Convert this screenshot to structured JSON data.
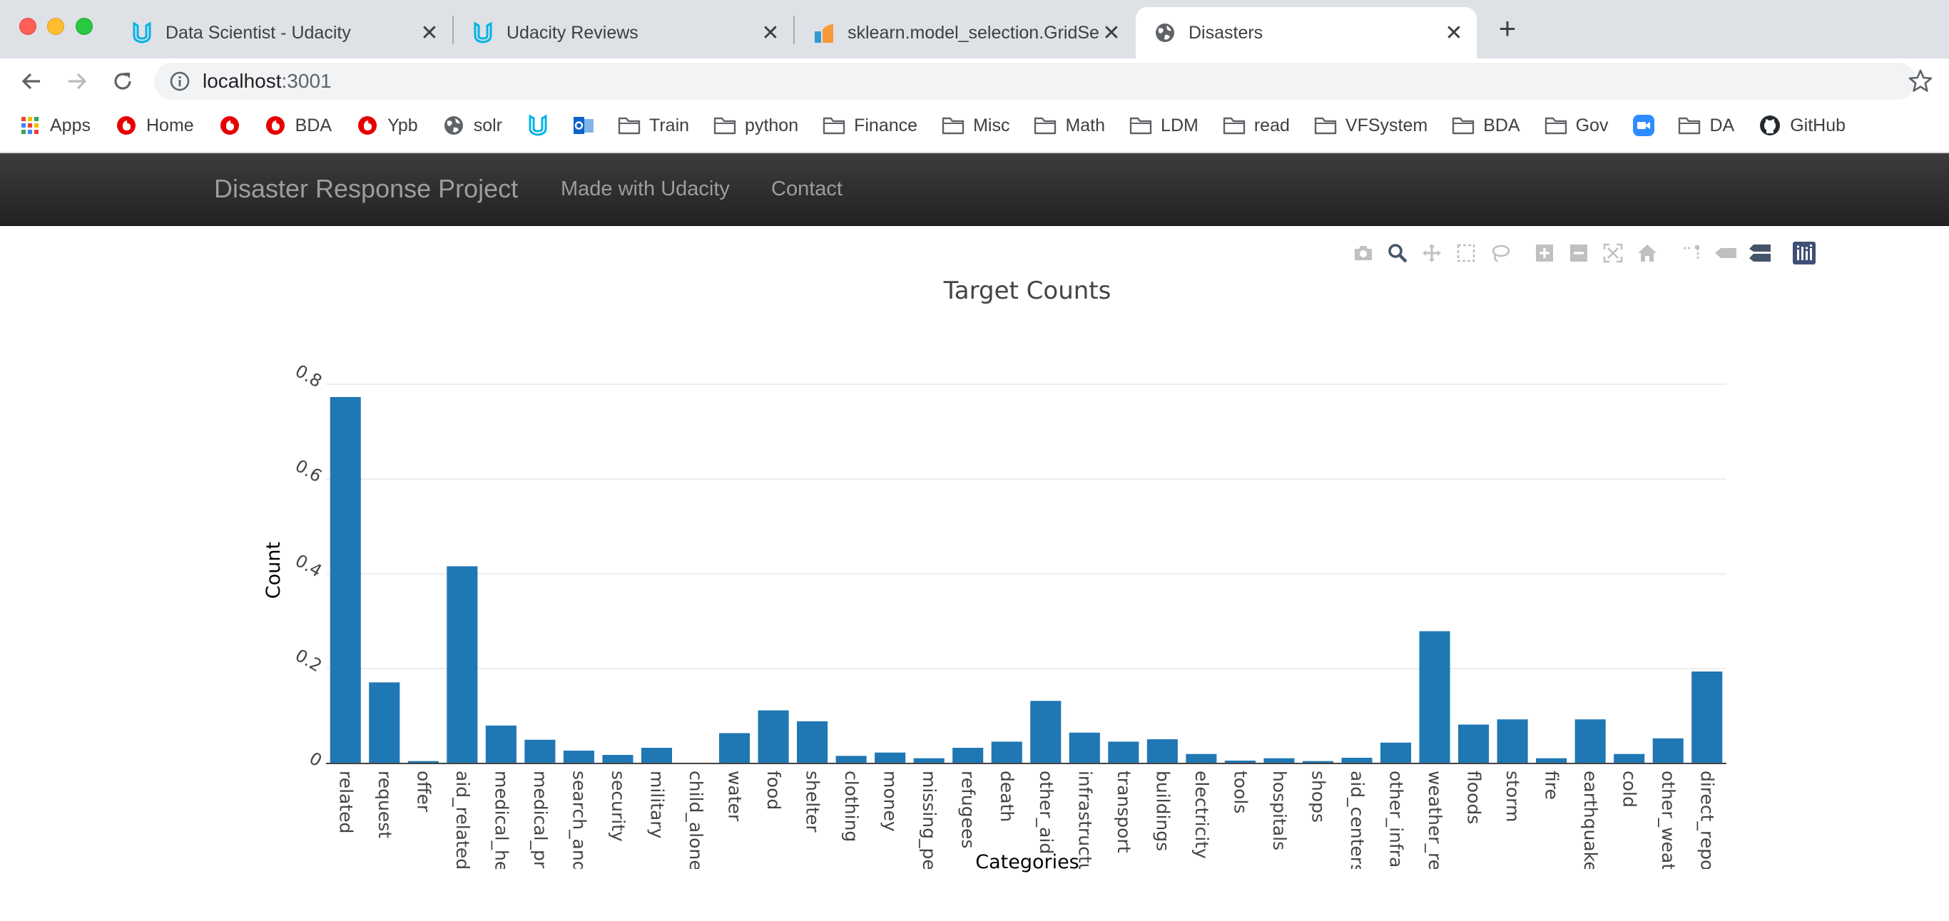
{
  "browser": {
    "tabs": [
      {
        "title": "Data Scientist - Udacity",
        "icon": "udacity-icon",
        "active": false
      },
      {
        "title": "Udacity Reviews",
        "icon": "udacity-icon",
        "active": false
      },
      {
        "title": "sklearn.model_selection.GridSe",
        "icon": "sklearn-icon",
        "active": false
      },
      {
        "title": "Disasters",
        "icon": "globe-icon",
        "active": true
      }
    ],
    "new_tab_label": "+",
    "close_glyph": "✕",
    "url_host": "localhost",
    "url_port": ":3001",
    "bookmarks": [
      {
        "label": "Apps",
        "icon": "apps-grid-icon"
      },
      {
        "label": "Home",
        "icon": "vodafone-icon"
      },
      {
        "label": "",
        "icon": "vodafone-icon"
      },
      {
        "label": "BDA",
        "icon": "vodafone-icon"
      },
      {
        "label": "Ypb",
        "icon": "vodafone-icon"
      },
      {
        "label": "solr",
        "icon": "globe-icon"
      },
      {
        "label": "",
        "icon": "udacity-icon"
      },
      {
        "label": "",
        "icon": "outlook-icon"
      },
      {
        "label": "Train",
        "icon": "folder-icon"
      },
      {
        "label": "python",
        "icon": "folder-icon"
      },
      {
        "label": "Finance",
        "icon": "folder-icon"
      },
      {
        "label": "Misc",
        "icon": "folder-icon"
      },
      {
        "label": "Math",
        "icon": "folder-icon"
      },
      {
        "label": "LDM",
        "icon": "folder-icon"
      },
      {
        "label": "read",
        "icon": "folder-icon"
      },
      {
        "label": "VFSystem",
        "icon": "folder-icon"
      },
      {
        "label": "BDA",
        "icon": "folder-icon"
      },
      {
        "label": "Gov",
        "icon": "folder-icon"
      },
      {
        "label": "",
        "icon": "zoom-icon"
      },
      {
        "label": "DA",
        "icon": "folder-icon"
      },
      {
        "label": "GitHub",
        "icon": "github-icon"
      }
    ]
  },
  "site": {
    "brand": "Disaster Response Project",
    "links": [
      "Made with Udacity",
      "Contact"
    ]
  },
  "modebar": {
    "buttons": [
      "camera-icon",
      "zoom-icon",
      "pan-icon",
      "box-select-icon",
      "lasso-select-icon",
      "zoom-in-icon",
      "zoom-out-icon",
      "autoscale-icon",
      "reset-axes-icon",
      "spike-lines-icon",
      "hover-closest-icon",
      "hover-compare-icon",
      "plotly-logo-icon"
    ]
  },
  "colors": {
    "bar": "#1f77b4",
    "grid": "#eeeeee",
    "navbar": "#222222",
    "nav_text": "#9d9d9d"
  },
  "chart_data": {
    "type": "bar",
    "title": "Target Counts",
    "xlabel": "Categories",
    "ylabel": "Count",
    "ylim": [
      0,
      0.8
    ],
    "yticks": [
      0,
      0.2,
      0.4,
      0.6,
      0.8
    ],
    "ytick_labels": [
      "0",
      "0.2",
      "0.4",
      "0.6",
      "0.8"
    ],
    "grid": true,
    "categories": [
      "related",
      "request",
      "offer",
      "aid_related",
      "medical_hel",
      "medical_pro",
      "search_and_",
      "security",
      "military",
      "child_alone",
      "water",
      "food",
      "shelter",
      "clothing",
      "money",
      "missing_pec",
      "refugees",
      "death",
      "other_aid",
      "infrastructur",
      "transport",
      "buildings",
      "electricity",
      "tools",
      "hospitals",
      "shops",
      "aid_centers",
      "other_infras",
      "weather_rel.",
      "floods",
      "storm",
      "fire",
      "earthquake",
      "cold",
      "other_weath",
      "direct_repor"
    ],
    "values": [
      0.773,
      0.171,
      0.005,
      0.416,
      0.08,
      0.05,
      0.027,
      0.018,
      0.033,
      0.0,
      0.064,
      0.112,
      0.089,
      0.016,
      0.023,
      0.011,
      0.033,
      0.046,
      0.132,
      0.065,
      0.046,
      0.051,
      0.02,
      0.006,
      0.011,
      0.005,
      0.012,
      0.044,
      0.279,
      0.082,
      0.093,
      0.011,
      0.093,
      0.02,
      0.053,
      0.194
    ]
  }
}
